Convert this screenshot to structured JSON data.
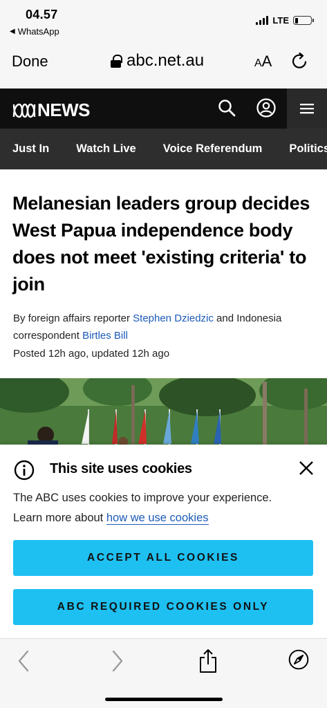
{
  "status_bar": {
    "time": "04.57",
    "back_app": "WhatsApp",
    "network": "LTE",
    "battery_level": 0.2
  },
  "browser": {
    "done_label": "Done",
    "url": "abc.net.au",
    "text_size_small": "A",
    "text_size_large": "A"
  },
  "site_header": {
    "logo_text": "NEWS",
    "icons": [
      "search-icon",
      "account-icon",
      "hamburger-menu-icon"
    ]
  },
  "nav": {
    "items": [
      {
        "label": "Just In"
      },
      {
        "label": "Watch Live"
      },
      {
        "label": "Voice Referendum"
      },
      {
        "label": "Politics"
      }
    ]
  },
  "article": {
    "headline": "Melanesian leaders group decides West Papua independence body does not meet 'existing criteria' to join",
    "byline_prefix": "By foreign affairs reporter ",
    "author_1": "Stephen Dziedzic",
    "byline_middle": " and Indonesia correspondent ",
    "author_2": "Birtles Bill",
    "posted": "Posted 12h ago, updated 12h ago"
  },
  "cookie_banner": {
    "title": "This site uses cookies",
    "text_1": "The ABC uses cookies to improve your experience.",
    "text_2_prefix": "Learn more about ",
    "link_text": "how we use cookies",
    "accept_all_label": "ACCEPT ALL COOKIES",
    "required_only_label": "ABC REQUIRED COOKIES ONLY"
  },
  "colors": {
    "header_bg": "#0f0f0f",
    "nav_bg": "#2e2e2e",
    "link": "#1c5ab8",
    "cookie_button": "#1ec0f2"
  },
  "toolbar": {
    "icons": [
      "back-icon",
      "forward-icon",
      "share-icon",
      "compass-icon"
    ]
  }
}
